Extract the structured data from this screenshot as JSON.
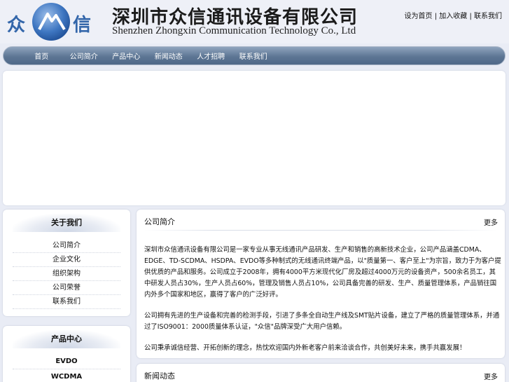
{
  "header": {
    "company_cn": "深圳市众信通讯设备有限公司",
    "company_en": "Shenzhen Zhongxin Communication Technology Co., Ltd",
    "logo_left_char": "众",
    "logo_right_char": "信",
    "top_link": "设为首页 | 加入收藏 | 联系我们"
  },
  "nav": {
    "items": [
      "首页",
      "公司简介",
      "产品中心",
      "新闻动态",
      "人才招聘",
      "联系我们"
    ]
  },
  "sidebar": {
    "about": {
      "title": "关于我们",
      "items": [
        "公司简介",
        "企业文化",
        "组织架构",
        "公司荣誉",
        "联系我们"
      ]
    },
    "products": {
      "title": "产品中心",
      "items": [
        "EVDO",
        "WCDMA"
      ]
    }
  },
  "main": {
    "intro": {
      "title": "公司简介",
      "more": "更多",
      "paragraphs": [
        "深圳市众信通讯设备有限公司是一家专业从事无线通讯产品研发、生产和销售的高新技术企业，公司产品涵盖CDMA、EDGE、TD-SCDMA、HSDPA、EVDO等多种制式的无线通讯终端产品，以\"质量第一、客户至上\"为宗旨，致力于为客户提供优质的产品和服务。公司成立于2008年，拥有4000平方米现代化厂房及超过4000万元的设备资产，500余名员工，其中研发人员占30%，生产人员占60%，管理及销售人员占10%，公司具备完善的研发、生产、质量管理体系，产品销往国内外多个国家和地区，赢得了客户的广泛好评。",
        "公司拥有先进的生产设备和完善的检测手段，引进了多条全自动生产线及SMT贴片设备，建立了严格的质量管理体系，并通过了ISO9001：2000质量体系认证，\"众信\"品牌深受广大用户信赖。",
        "公司秉承诚信经营、开拓创新的理念，热忱欢迎国内外新老客户前来洽谈合作，共创美好未来，携手共赢发展！"
      ]
    },
    "news": {
      "title": "新闻动态",
      "more": "更多"
    }
  },
  "colors": {
    "nav_start": "#8fa4bd",
    "nav_end": "#4f6888",
    "logo_blue": "#3366aa",
    "page_bg": "#e9ecf5"
  }
}
